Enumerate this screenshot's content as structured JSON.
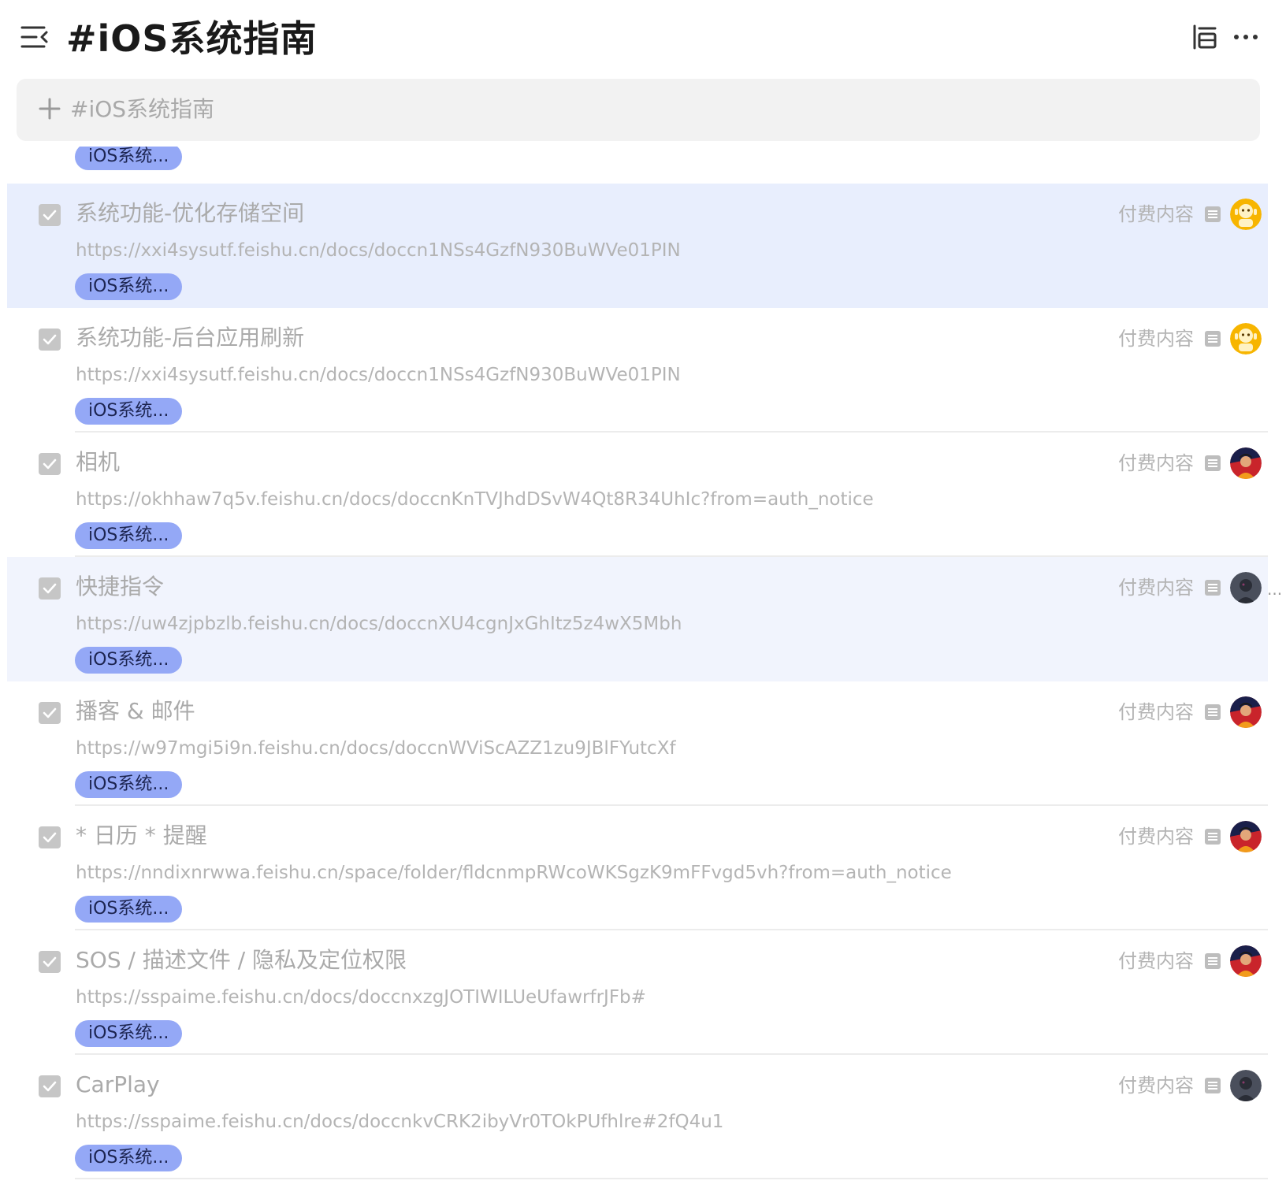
{
  "header": {
    "title": "#iOS系统指南"
  },
  "add_task": {
    "placeholder": "#iOS系统指南"
  },
  "tag_label": "iOS系统...",
  "paid_label": "付费内容",
  "colors": {
    "selected_row": "#e8eefd",
    "hover_row": "#f1f4fd",
    "tag_bg": "#94a8f6",
    "checkbox": "#c6c6c6"
  },
  "tasks": [
    {
      "title": "系统功能-优化存储空间",
      "url": "https://xxi4sysutf.feishu.cn/docs/doccn1NSs4GzfN930BuWVe01PIN",
      "tag": "iOS系统...",
      "paid": "付费内容",
      "avatar": "yellow-character-avatar",
      "checked": true,
      "state": "selected"
    },
    {
      "title": "系统功能-后台应用刷新",
      "url": "https://xxi4sysutf.feishu.cn/docs/doccn1NSs4GzfN930BuWVe01PIN",
      "tag": "iOS系统...",
      "paid": "付费内容",
      "avatar": "yellow-character-avatar",
      "checked": true,
      "state": "normal"
    },
    {
      "title": "相机",
      "url": "https://okhhaw7q5v.feishu.cn/docs/doccnKnTVJhdDSvW4Qt8R34UhIc?from=auth_notice",
      "tag": "iOS系统...",
      "paid": "付费内容",
      "avatar": "red-person-avatar",
      "checked": true,
      "state": "normal"
    },
    {
      "title": "快捷指令",
      "url": "https://uw4zjpbzlb.feishu.cn/docs/doccnXU4cgnJxGhItz5z4wX5Mbh",
      "tag": "iOS系统...",
      "paid": "付费内容",
      "avatar": "dark-person-avatar",
      "checked": true,
      "state": "hover"
    },
    {
      "title": "播客 & 邮件",
      "url": "https://w97mgi5i9n.feishu.cn/docs/doccnWViScAZZ1zu9JBlFYutcXf",
      "tag": "iOS系统...",
      "paid": "付费内容",
      "avatar": "red-person-avatar",
      "checked": true,
      "state": "normal"
    },
    {
      "title": "* 日历 * 提醒",
      "url": "https://nndixnrwwa.feishu.cn/space/folder/fldcnmpRWcoWKSgzK9mFFvgd5vh?from=auth_notice",
      "tag": "iOS系统...",
      "paid": "付费内容",
      "avatar": "red-person-avatar",
      "checked": true,
      "state": "normal"
    },
    {
      "title": "SOS / 描述文件 / 隐私及定位权限",
      "url": "https://sspaime.feishu.cn/docs/doccnxzgJOTIWILUeUfawrfrJFb#",
      "tag": "iOS系统...",
      "paid": "付费内容",
      "avatar": "red-person-avatar",
      "checked": true,
      "state": "normal"
    },
    {
      "title": "CarPlay",
      "url": "https://sspaime.feishu.cn/docs/doccnkvCRK2ibyVr0TOkPUfhlre#2fQ4u1",
      "tag": "iOS系统...",
      "paid": "付费内容",
      "avatar": "dark-person-avatar",
      "checked": true,
      "state": "normal"
    }
  ]
}
